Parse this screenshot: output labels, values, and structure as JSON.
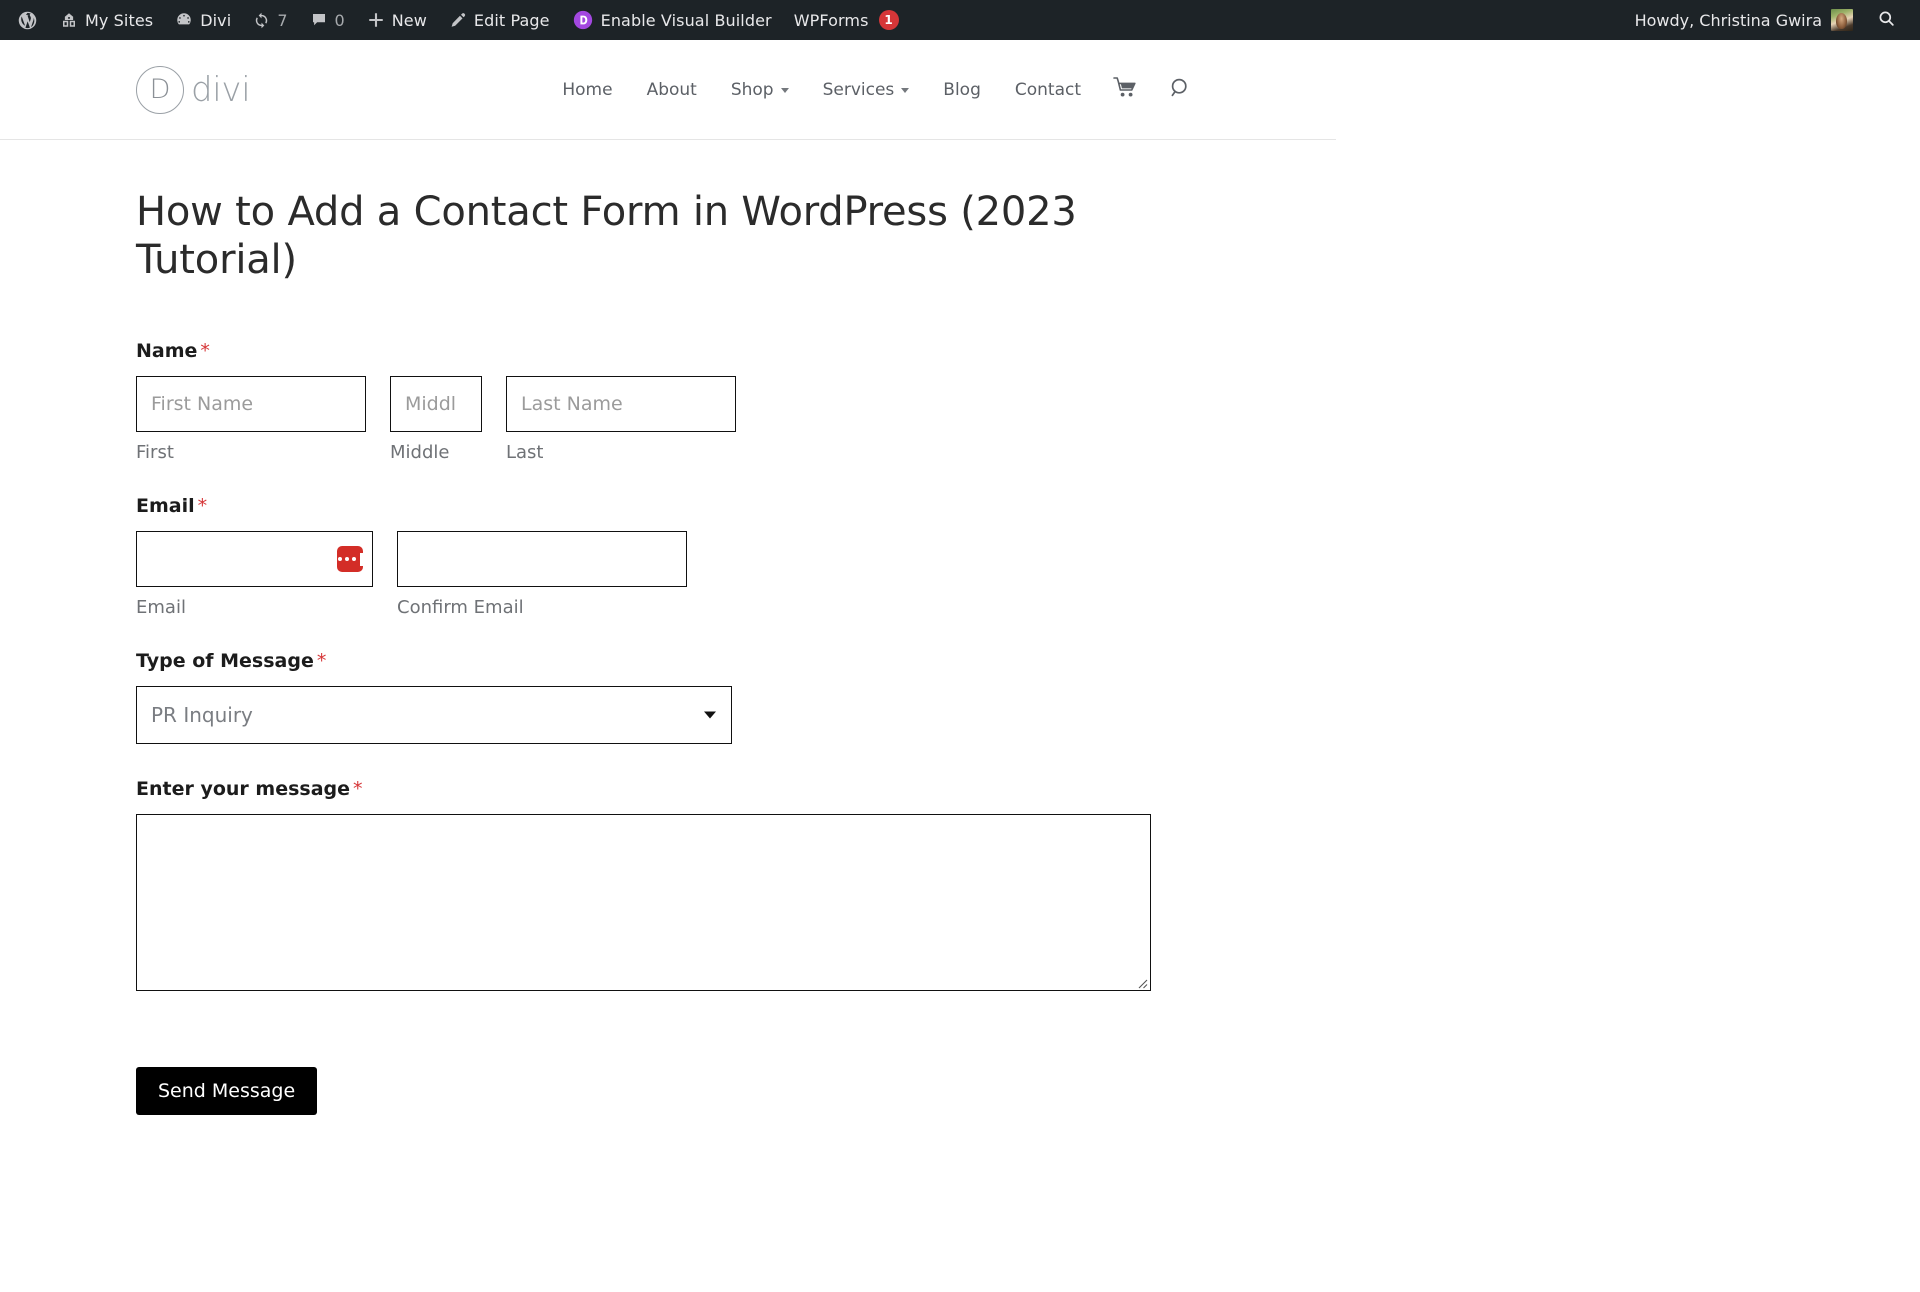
{
  "adminbar": {
    "wp_logo": "wordpress-logo",
    "items": [
      {
        "icon": "multisite-icon",
        "label": "My Sites"
      },
      {
        "icon": "dashboard-icon",
        "label": "Divi"
      },
      {
        "icon": "updates-icon",
        "label": "",
        "count": "7"
      },
      {
        "icon": "comments-icon",
        "label": "",
        "count": "0"
      },
      {
        "icon": "plus-icon",
        "label": "New"
      },
      {
        "icon": "pencil-icon",
        "label": "Edit Page"
      },
      {
        "icon": "divi-d-icon",
        "label": "Enable Visual Builder"
      },
      {
        "icon": "",
        "label": "WPForms",
        "badge": "1"
      }
    ],
    "howdy": "Howdy, Christina Gwira",
    "search_icon": "search-icon"
  },
  "header": {
    "logo_mark": "D",
    "logo_text": "divi",
    "nav": [
      {
        "label": "Home",
        "has_caret": false
      },
      {
        "label": "About",
        "has_caret": false
      },
      {
        "label": "Shop",
        "has_caret": true
      },
      {
        "label": "Services",
        "has_caret": true
      },
      {
        "label": "Blog",
        "has_caret": false
      },
      {
        "label": "Contact",
        "has_caret": false
      }
    ],
    "cart_icon": "shopping-cart-icon",
    "search_icon": "search-icon"
  },
  "page": {
    "title": "How to Add a Contact Form in WordPress (2023 Tutorial)"
  },
  "form": {
    "required_mark": "*",
    "name": {
      "label": "Name",
      "first": {
        "placeholder": "First Name",
        "value": "",
        "sublabel": "First"
      },
      "middle": {
        "placeholder": "Middl",
        "value": "",
        "sublabel": "Middle"
      },
      "last": {
        "placeholder": "Last Name",
        "value": "",
        "sublabel": "Last"
      }
    },
    "email": {
      "label": "Email",
      "primary": {
        "placeholder": "",
        "value": "",
        "sublabel": "Email"
      },
      "confirm": {
        "placeholder": "",
        "value": "",
        "sublabel": "Confirm Email"
      },
      "autofill_icon": "lastpass-autofill-icon"
    },
    "message_type": {
      "label": "Type of Message",
      "selected": "PR Inquiry",
      "arrow_icon": "chevron-down-icon"
    },
    "message": {
      "label": "Enter your message",
      "placeholder": "",
      "value": ""
    },
    "submit_label": "Send Message"
  },
  "colors": {
    "adminbar_bg": "#1d2327",
    "required_red": "#d63638",
    "badge_red": "#d63638",
    "divi_purple": "#a348e0",
    "lastpass_red": "#d32d27",
    "button_bg": "#000000",
    "nav_text": "#5c6066",
    "logo_gray": "#9aa0a6"
  }
}
